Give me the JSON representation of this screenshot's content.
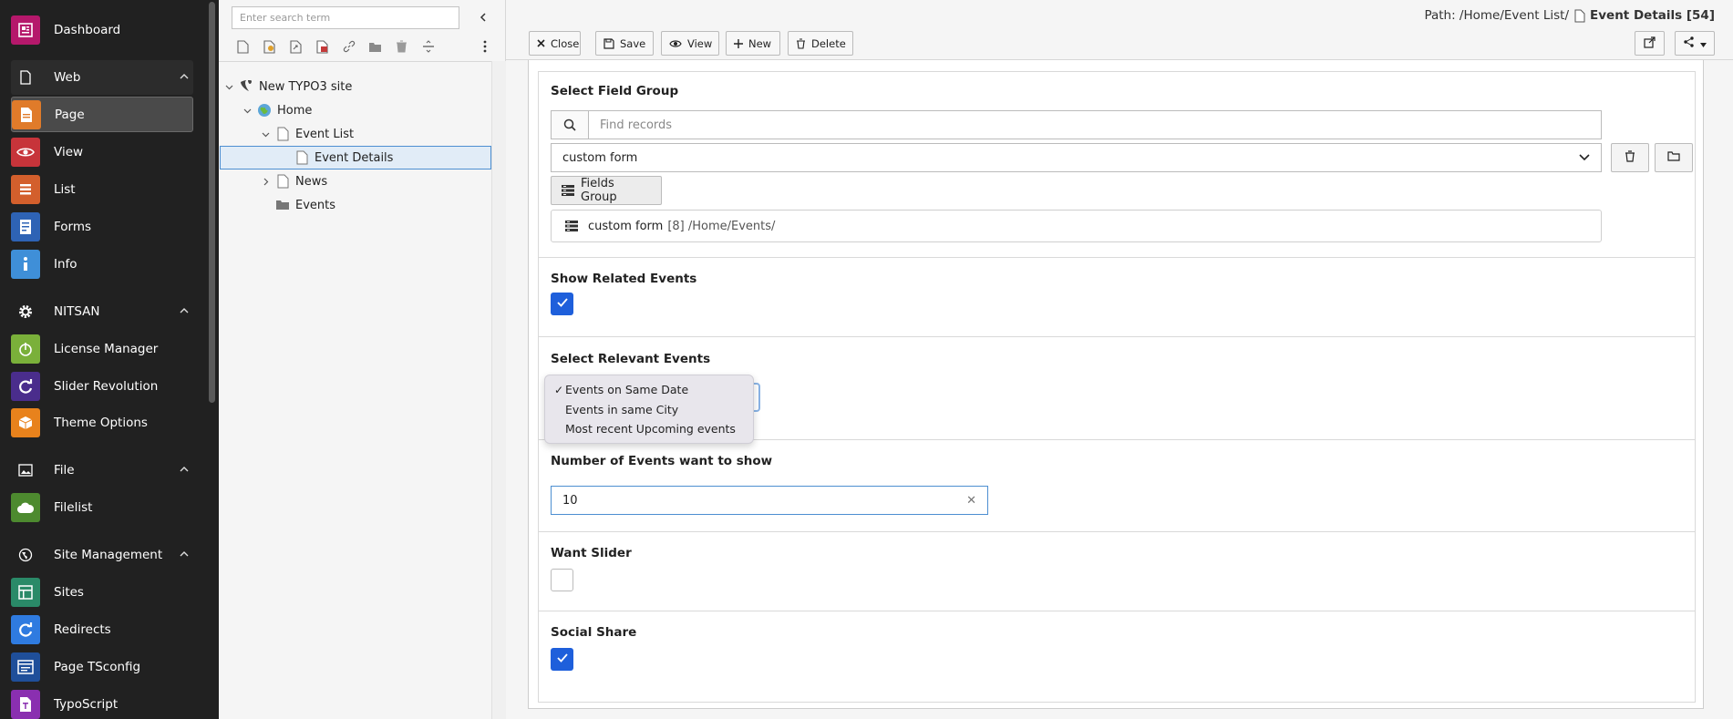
{
  "sidebar": {
    "items": [
      {
        "label": "Dashboard",
        "color": "#b5186b",
        "icon": "dashboard-icon"
      },
      {
        "label": "Web",
        "icon": "page-outline-icon"
      },
      {
        "label": "Page",
        "color": "#e07b2a",
        "icon": "page-icon"
      },
      {
        "label": "View",
        "color": "#c7343a",
        "icon": "eye-icon"
      },
      {
        "label": "List",
        "color": "#d35f2c",
        "icon": "list-icon"
      },
      {
        "label": "Forms",
        "color": "#2e63b5",
        "icon": "forms-icon"
      },
      {
        "label": "Info",
        "color": "#3f8fd8",
        "icon": "info-icon"
      },
      {
        "label": "NITSAN",
        "icon": "gear-icon"
      },
      {
        "label": "License Manager",
        "color": "#7ab03a",
        "icon": "power-icon"
      },
      {
        "label": "Slider Revolution",
        "color": "#4a2d8c",
        "icon": "refresh-icon"
      },
      {
        "label": "Theme Options",
        "color": "#e8821c",
        "icon": "box-icon"
      },
      {
        "label": "File",
        "icon": "image-icon"
      },
      {
        "label": "Filelist",
        "color": "#4d8a2f",
        "icon": "cloud-icon"
      },
      {
        "label": "Site Management",
        "icon": "globe-icon"
      },
      {
        "label": "Sites",
        "color": "#2a8a68",
        "icon": "sites-icon"
      },
      {
        "label": "Redirects",
        "color": "#2f7be0",
        "icon": "redirect-icon"
      },
      {
        "label": "Page TSconfig",
        "color": "#1f4f9a",
        "icon": "tsconfig-icon"
      },
      {
        "label": "TypoScript",
        "color": "#8a2fb0",
        "icon": "typoscript-icon"
      }
    ]
  },
  "tree": {
    "search_placeholder": "Enter search term",
    "nodes": [
      {
        "label": "New TYPO3 site"
      },
      {
        "label": "Home"
      },
      {
        "label": "Event List"
      },
      {
        "label": "Event Details"
      },
      {
        "label": "News"
      },
      {
        "label": "Events"
      }
    ]
  },
  "topbar": {
    "path_prefix": "Path: /Home/Event List/",
    "path_current": "Event Details [54]",
    "buttons": {
      "close": "Close",
      "save": "Save",
      "view": "View",
      "new": "New",
      "delete": "Delete"
    }
  },
  "form": {
    "field_group": {
      "label": "Select Field Group",
      "find_placeholder": "Find records",
      "selected": "custom form",
      "button": "Fields Group",
      "record_title": "custom form",
      "record_meta": "[8] /Home/Events/"
    },
    "related_events": {
      "label": "Show Related Events",
      "checked": true
    },
    "relevant_events": {
      "label": "Select Relevant Events",
      "options": [
        {
          "label": "Events on Same Date",
          "checked": "✓"
        },
        {
          "label": "Events in same City"
        },
        {
          "label": "Most recent Upcoming events"
        }
      ]
    },
    "number_events": {
      "label": "Number of Events want to show",
      "value": "10"
    },
    "want_slider": {
      "label": "Want Slider",
      "checked": false
    },
    "social_share": {
      "label": "Social Share",
      "checked": true
    }
  },
  "colors": {
    "accent": "#1e5fdb",
    "sidebar_bg": "#212121",
    "selection": "#4d8fd1"
  }
}
